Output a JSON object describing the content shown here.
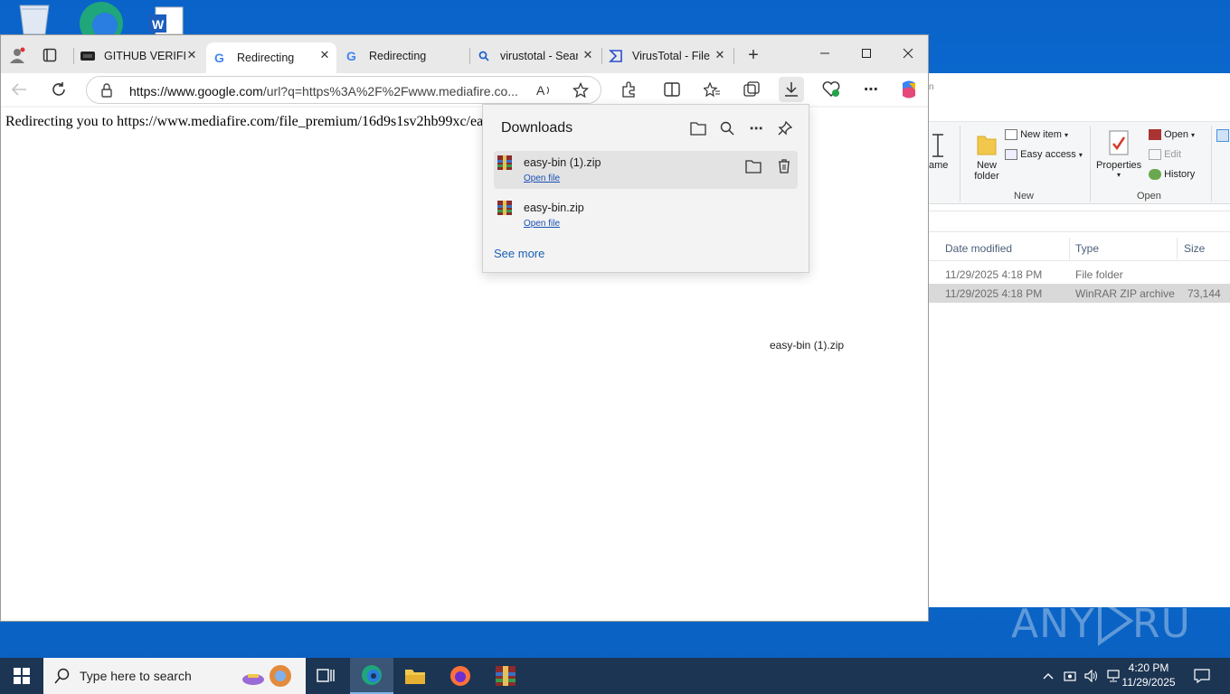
{
  "browser": {
    "tabs": [
      {
        "title": "GITHUB VERIFIED",
        "icon": "github-icon"
      },
      {
        "title": "Redirecting",
        "icon": "google-icon",
        "active": true
      },
      {
        "title": "Redirecting",
        "icon": "google-icon"
      },
      {
        "title": "virustotal - Sear",
        "icon": "search-icon"
      },
      {
        "title": "VirusTotal - File",
        "icon": "virustotal-icon"
      }
    ],
    "url_host": "https://www.google.com",
    "url_rest": "/url?q=https%3A%2F%2Fwww.mediafire.co...",
    "page_text": "Redirecting you to https://www.mediafire.com/file_premium/16d9s1sv2hb99xc/ea",
    "drag_label": "easy-bin (1).zip"
  },
  "downloads": {
    "title": "Downloads",
    "items": [
      {
        "name": "easy-bin (1).zip",
        "action": "Open file"
      },
      {
        "name": "easy-bin.zip",
        "action": "Open file"
      }
    ],
    "see_more": "See more"
  },
  "explorer": {
    "partial_label": "ame",
    "new_folder": "New",
    "new_folder_2": "folder",
    "new_item": "New item",
    "easy_access": "Easy access",
    "group_new": "New",
    "properties": "Properties",
    "open": "Open",
    "edit": "Edit",
    "history": "History",
    "group_open": "Open",
    "columns": {
      "date": "Date modified",
      "type": "Type",
      "size": "Size"
    },
    "rows": [
      {
        "date": "11/29/2025 4:18 PM",
        "type": "File folder",
        "size": ""
      },
      {
        "date": "11/29/2025 4:18 PM",
        "type": "WinRAR ZIP archive",
        "size": "73,144"
      }
    ]
  },
  "taskbar": {
    "search_placeholder": "Type here to search",
    "time": "4:20 PM",
    "date": "11/29/2025"
  },
  "watermark": "ANY RUN"
}
